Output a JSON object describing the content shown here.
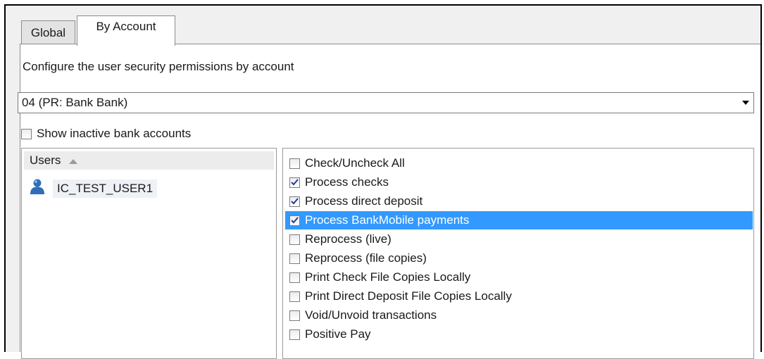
{
  "tabs": [
    {
      "label": "Global",
      "active": false
    },
    {
      "label": "By Account",
      "active": true
    }
  ],
  "description": "Configure the user security permissions by account",
  "account_select": {
    "value": "04 (PR: Bank Bank)"
  },
  "show_inactive": {
    "label": "Show inactive bank accounts",
    "checked": false
  },
  "users": {
    "header": "Users",
    "sort": "ascending",
    "items": [
      {
        "name": "IC_TEST_USER1"
      }
    ]
  },
  "permissions": [
    {
      "label": "Check/Uncheck All",
      "checked": false
    },
    {
      "label": "Process checks",
      "checked": true
    },
    {
      "label": "Process direct deposit",
      "checked": true
    },
    {
      "label": "Process BankMobile payments",
      "checked": true,
      "selected": true
    },
    {
      "label": "Reprocess (live)",
      "checked": false
    },
    {
      "label": "Reprocess (file copies)",
      "checked": false
    },
    {
      "label": "Print Check File Copies Locally",
      "checked": false
    },
    {
      "label": "Print Direct Deposit File Copies Locally",
      "checked": false
    },
    {
      "label": "Void/Unvoid transactions",
      "checked": false
    },
    {
      "label": "Positive Pay",
      "checked": false
    }
  ],
  "colors": {
    "selection": "#3399ff",
    "user_icon": "#2f6fb8"
  }
}
